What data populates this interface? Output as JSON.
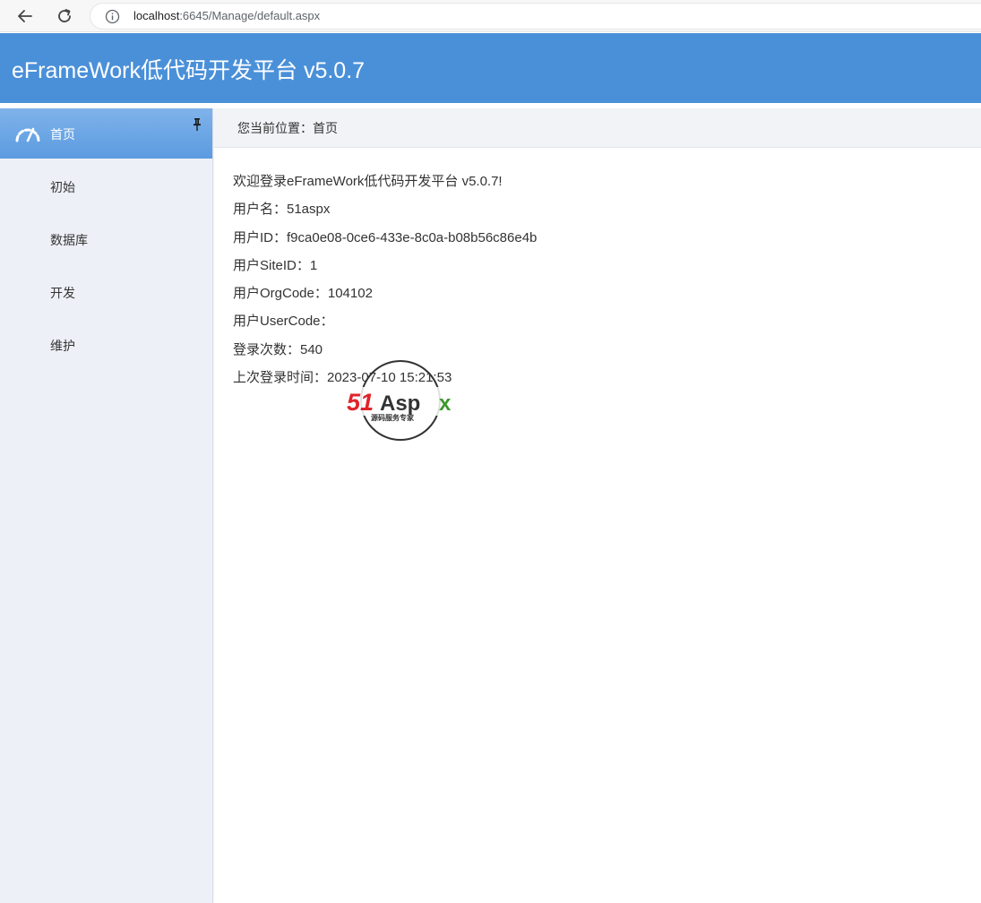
{
  "browser": {
    "url_host": "localhost",
    "url_rest": ":6645/Manage/default.aspx"
  },
  "header": {
    "title": "eFrameWork低代码开发平台 v5.0.7"
  },
  "sidebar": {
    "items": [
      {
        "label": "首页",
        "active": true,
        "icon": "dashboard-icon"
      },
      {
        "label": "初始"
      },
      {
        "label": "数据库"
      },
      {
        "label": "开发"
      },
      {
        "label": "维护"
      }
    ],
    "pin_icon": "pin-icon"
  },
  "breadcrumb": {
    "text": "您当前位置：首页"
  },
  "info": {
    "welcome": "欢迎登录eFrameWork低代码开发平台 v5.0.7!",
    "username": "用户名：51aspx",
    "user_id": "用户ID：f9ca0e08-0ce6-433e-8c0a-b08b56c86e4b",
    "site_id": "用户SiteID：1",
    "org_code": "用户OrgCode：104102",
    "user_code": "用户UserCode：",
    "login_count": "登录次数：540",
    "last_login": "上次登录时间：2023-07-10 15:21:53"
  },
  "logo": {
    "brand": "51Aspx",
    "tagline": "源码服务专家",
    "colors": {
      "red": "#e0232a",
      "green": "#3a9a2a",
      "ring": "#333333"
    }
  },
  "colors": {
    "header_bg": "#4a90d9",
    "sidebar_bg": "#edf0f7",
    "active_item": "#5b9be0"
  }
}
